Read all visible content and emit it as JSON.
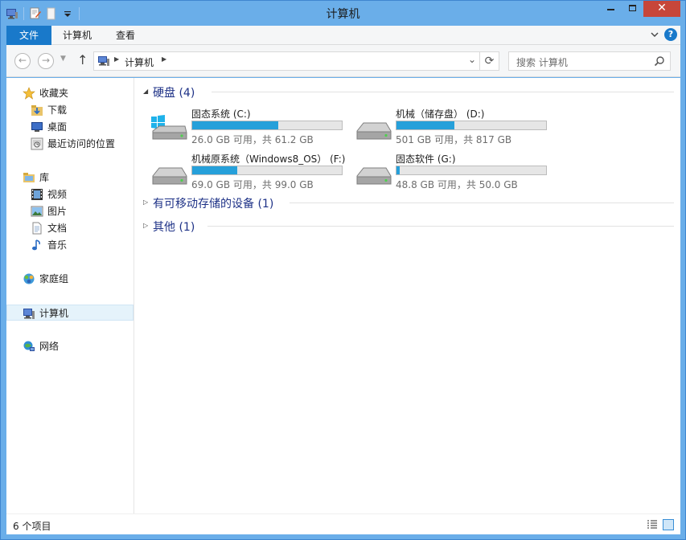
{
  "window": {
    "title": "计算机"
  },
  "ribbon": {
    "tabs": [
      {
        "label": "文件"
      },
      {
        "label": "计算机"
      },
      {
        "label": "查看"
      }
    ],
    "help_label": "?"
  },
  "address": {
    "crumbs": [
      "计算机"
    ],
    "refresh_glyph": "⟳"
  },
  "search": {
    "placeholder": "搜索 计算机"
  },
  "sidebar": {
    "favorites": {
      "label": "收藏夹",
      "icon": "star-icon"
    },
    "favorite_items": [
      {
        "label": "下载",
        "icon": "download-folder-icon"
      },
      {
        "label": "桌面",
        "icon": "desktop-icon"
      },
      {
        "label": "最近访问的位置",
        "icon": "recent-places-icon"
      }
    ],
    "libraries": {
      "label": "库",
      "icon": "library-icon"
    },
    "library_items": [
      {
        "label": "视频",
        "icon": "video-icon"
      },
      {
        "label": "图片",
        "icon": "picture-icon"
      },
      {
        "label": "文档",
        "icon": "document-icon"
      },
      {
        "label": "音乐",
        "icon": "music-icon"
      }
    ],
    "homegroup": {
      "label": "家庭组",
      "icon": "homegroup-icon"
    },
    "computer": {
      "label": "计算机",
      "icon": "computer-icon"
    },
    "network": {
      "label": "网络",
      "icon": "network-icon"
    }
  },
  "content": {
    "groups": [
      {
        "label": "硬盘 (4)",
        "expanded": true
      },
      {
        "label": "有可移动存储的设备 (1)",
        "expanded": false
      },
      {
        "label": "其他 (1)",
        "expanded": false
      }
    ],
    "drives": [
      {
        "name": "固态系统 (C:)",
        "free": "26.0 GB 可用，共 61.2 GB",
        "used_fraction": 0.575,
        "icon": "windows-drive-icon"
      },
      {
        "name": "机械（储存盘） (D:)",
        "free": "501 GB 可用，共 817 GB",
        "used_fraction": 0.387,
        "icon": "hard-drive-icon"
      },
      {
        "name": "机械原系统（Windows8_OS） (F:)",
        "free": "69.0 GB 可用，共 99.0 GB",
        "used_fraction": 0.303,
        "icon": "hard-drive-icon"
      },
      {
        "name": "固态软件 (G:)",
        "free": "48.8 GB 可用，共 50.0 GB",
        "used_fraction": 0.024,
        "icon": "hard-drive-icon"
      }
    ]
  },
  "status": {
    "count": "6 个项目"
  },
  "colors": {
    "accent": "#1979ca",
    "bar_fill": "#26a0da",
    "group_title": "#1e3287",
    "frame": "#6aaee9"
  }
}
